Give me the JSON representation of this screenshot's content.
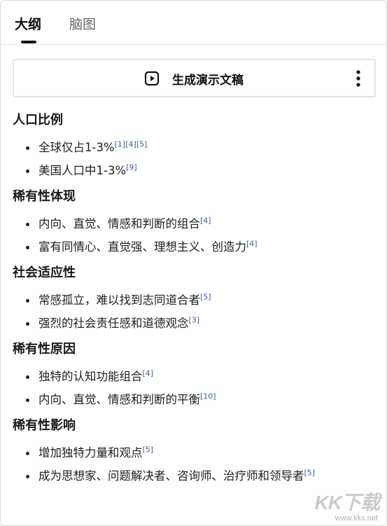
{
  "tabs": [
    {
      "label": "大纲",
      "active": true
    },
    {
      "label": "脑图",
      "active": false
    }
  ],
  "generate_bar": {
    "label": "生成演示文稿",
    "icon": "play-icon",
    "more_icon": "more-vertical-icon"
  },
  "sections": [
    {
      "title": "人口比例",
      "items": [
        {
          "text": "全球仅占1-3%",
          "cites": [
            "[1]",
            "[4]",
            "[5]"
          ]
        },
        {
          "text": "美国人口中1-3%",
          "cites": [
            "[9]"
          ]
        }
      ]
    },
    {
      "title": "稀有性体现",
      "items": [
        {
          "text": "内向、直觉、情感和判断的组合",
          "cites": [
            "[4]"
          ]
        },
        {
          "text": "富有同情心、直觉强、理想主义、创造力",
          "cites": [
            "[4]"
          ]
        }
      ]
    },
    {
      "title": "社会适应性",
      "items": [
        {
          "text": "常感孤立，难以找到志同道合者",
          "cites": [
            "[5]"
          ]
        },
        {
          "text": "强烈的社会责任感和道德观念",
          "cites": [
            "[3]"
          ]
        }
      ]
    },
    {
      "title": "稀有性原因",
      "items": [
        {
          "text": "独特的认知功能组合",
          "cites": [
            "[4]"
          ]
        },
        {
          "text": "内向、直觉、情感和判断的平衡",
          "cites": [
            "[10]"
          ]
        }
      ]
    },
    {
      "title": "稀有性影响",
      "items": [
        {
          "text": "增加独特力量和观点",
          "cites": [
            "[5]"
          ]
        },
        {
          "text": "成为思想家、问题解决者、咨询师、治疗师和领导者",
          "cites": [
            "[5]"
          ]
        }
      ]
    }
  ],
  "watermark": {
    "text": "KK下载",
    "url": "www.kkx.net"
  },
  "colors": {
    "citation": "#3f5ea8",
    "text": "#1f1f1f",
    "border": "#e4e4e4"
  }
}
